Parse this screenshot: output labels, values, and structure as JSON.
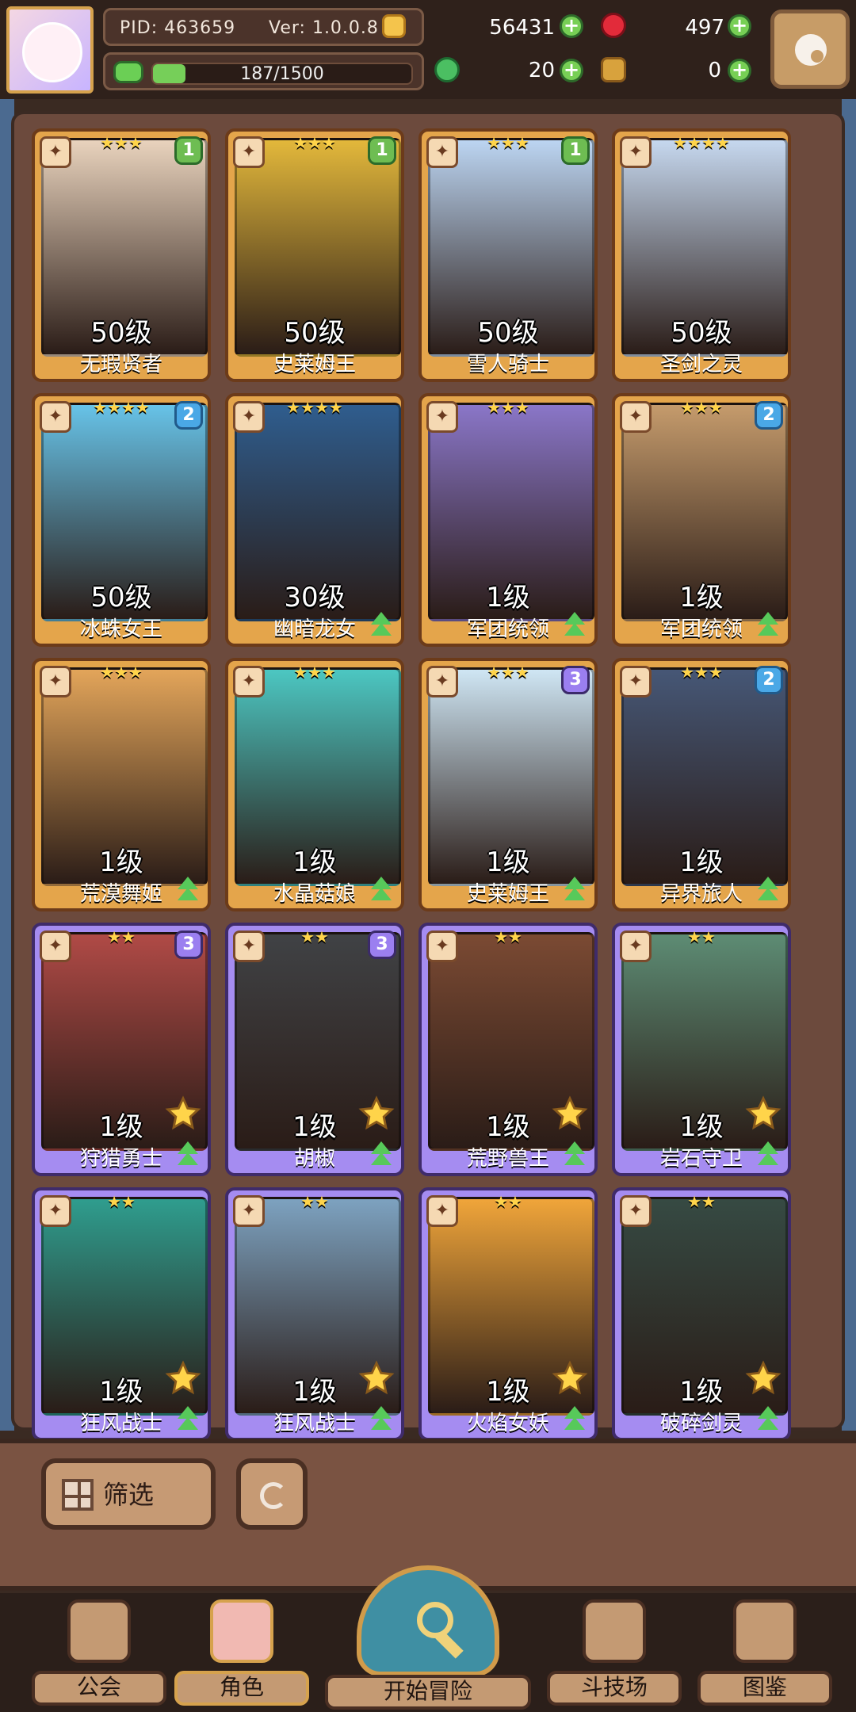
{
  "header": {
    "pid_label": "PID: 463659",
    "version_label": "Ver: 1.0.0.8",
    "gold": "56431",
    "gems": "497",
    "exp_text": "187/1500",
    "exp_progress": 0.1247,
    "clover": "20",
    "bottle": "0"
  },
  "characters": [
    {
      "name": "无瑕贤者",
      "level": "50级",
      "stars": 3,
      "rank": "1",
      "rank_color": "green",
      "rarity": "gold",
      "upgrade": false,
      "bigstar": false,
      "portrait": "#e9d3bd"
    },
    {
      "name": "史莱姆王",
      "level": "50级",
      "stars": 3,
      "rank": "1",
      "rank_color": "green",
      "rarity": "gold",
      "upgrade": false,
      "bigstar": false,
      "portrait": "#e3b83b"
    },
    {
      "name": "雪人骑士",
      "level": "50级",
      "stars": 3,
      "rank": "1",
      "rank_color": "green",
      "rarity": "gold",
      "upgrade": false,
      "bigstar": false,
      "portrait": "#bcd5f2"
    },
    {
      "name": "圣剑之灵",
      "level": "50级",
      "stars": 4,
      "rank": "",
      "rank_color": "",
      "rarity": "gold",
      "upgrade": false,
      "bigstar": false,
      "portrait": "#c6d8ef"
    },
    {
      "name": "冰蛛女王",
      "level": "50级",
      "stars": 4,
      "rank": "2",
      "rank_color": "blue",
      "rarity": "gold",
      "upgrade": false,
      "bigstar": false,
      "portrait": "#67c3e8"
    },
    {
      "name": "幽暗龙女",
      "level": "30级",
      "stars": 4,
      "rank": "",
      "rank_color": "",
      "rarity": "gold",
      "upgrade": true,
      "bigstar": false,
      "portrait": "#2f5d8e"
    },
    {
      "name": "军团统领",
      "level": "1级",
      "stars": 3,
      "rank": "",
      "rank_color": "",
      "rarity": "gold",
      "upgrade": true,
      "bigstar": false,
      "portrait": "#8a76c8"
    },
    {
      "name": "军团统领",
      "level": "1级",
      "stars": 3,
      "rank": "2",
      "rank_color": "blue",
      "rarity": "gold",
      "upgrade": true,
      "bigstar": false,
      "portrait": "#c59b6c"
    },
    {
      "name": "荒漠舞姬",
      "level": "1级",
      "stars": 3,
      "rank": "",
      "rank_color": "",
      "rarity": "gold",
      "upgrade": true,
      "bigstar": false,
      "portrait": "#e3a55a"
    },
    {
      "name": "水晶菇娘",
      "level": "1级",
      "stars": 3,
      "rank": "",
      "rank_color": "",
      "rarity": "gold",
      "upgrade": true,
      "bigstar": false,
      "portrait": "#4cc7c2"
    },
    {
      "name": "史莱姆王",
      "level": "1级",
      "stars": 3,
      "rank": "3",
      "rank_color": "purple",
      "rarity": "gold",
      "upgrade": true,
      "bigstar": false,
      "portrait": "#cfe6f4"
    },
    {
      "name": "异界旅人",
      "level": "1级",
      "stars": 3,
      "rank": "2",
      "rank_color": "blue",
      "rarity": "gold",
      "upgrade": true,
      "bigstar": false,
      "portrait": "#465776"
    },
    {
      "name": "狩猎勇士",
      "level": "1级",
      "stars": 2,
      "rank": "3",
      "rank_color": "purple",
      "rarity": "purple",
      "upgrade": true,
      "bigstar": true,
      "portrait": "#b04a46"
    },
    {
      "name": "胡椒",
      "level": "1级",
      "stars": 2,
      "rank": "3",
      "rank_color": "purple",
      "rarity": "purple",
      "upgrade": true,
      "bigstar": true,
      "portrait": "#404245"
    },
    {
      "name": "荒野兽王",
      "level": "1级",
      "stars": 2,
      "rank": "",
      "rank_color": "",
      "rarity": "purple",
      "upgrade": true,
      "bigstar": true,
      "portrait": "#7b4a33"
    },
    {
      "name": "岩石守卫",
      "level": "1级",
      "stars": 2,
      "rank": "",
      "rank_color": "",
      "rarity": "purple",
      "upgrade": true,
      "bigstar": true,
      "portrait": "#5d8c74"
    },
    {
      "name": "狂风战士",
      "level": "1级",
      "stars": 2,
      "rank": "",
      "rank_color": "",
      "rarity": "purple",
      "upgrade": true,
      "bigstar": true,
      "portrait": "#2f9d8e"
    },
    {
      "name": "狂风战士",
      "level": "1级",
      "stars": 2,
      "rank": "",
      "rank_color": "",
      "rarity": "purple",
      "upgrade": true,
      "bigstar": true,
      "portrait": "#7da2c0"
    },
    {
      "name": "火焰女妖",
      "level": "1级",
      "stars": 2,
      "rank": "",
      "rank_color": "",
      "rarity": "purple",
      "upgrade": true,
      "bigstar": true,
      "portrait": "#f0a53a"
    },
    {
      "name": "破碎剑灵",
      "level": "1级",
      "stars": 2,
      "rank": "",
      "rank_color": "",
      "rarity": "purple",
      "upgrade": true,
      "bigstar": true,
      "portrait": "#364a43"
    }
  ],
  "controls": {
    "filter_label": "筛选"
  },
  "nav": {
    "guild": "公会",
    "role": "角色",
    "start": "开始冒险",
    "arena": "斗技场",
    "codex": "图鉴"
  }
}
